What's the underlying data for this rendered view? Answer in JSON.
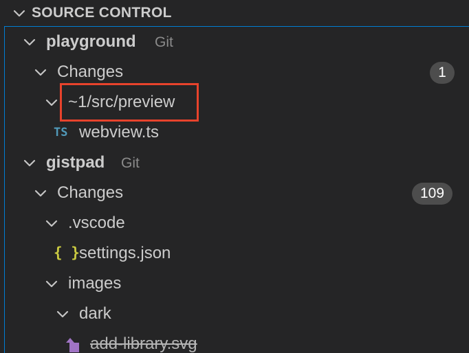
{
  "panel": {
    "title": "SOURCE CONTROL"
  },
  "repos": [
    {
      "name": "playground",
      "scm": "Git",
      "changes_label": "Changes",
      "changes_count": "1",
      "folder": "~1/src/preview",
      "file": {
        "name": "webview.ts",
        "icon": "typescript-icon",
        "icon_text": "TS"
      }
    },
    {
      "name": "gistpad",
      "scm": "Git",
      "changes_label": "Changes",
      "changes_count": "109",
      "folder_vscode": ".vscode",
      "file_settings": {
        "name": "settings.json",
        "icon": "json-icon",
        "icon_text": "{ }"
      },
      "folder_images": "images",
      "folder_dark": "dark",
      "file_add_library": {
        "name": "add-library.svg",
        "icon": "svg-file-icon",
        "status": "deleted"
      }
    }
  ],
  "colors": {
    "background": "#252526",
    "focus_border": "#007fd4",
    "highlight_annotation": "#e8432c",
    "ts_icon": "#519aba",
    "json_icon": "#cbcb41",
    "svg_icon": "#a074c4"
  }
}
